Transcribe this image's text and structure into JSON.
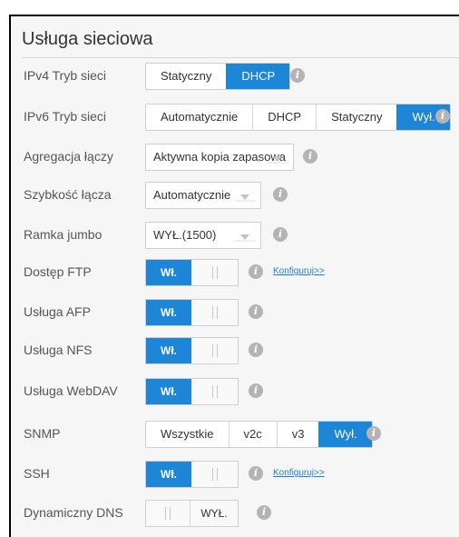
{
  "section": {
    "title": "Usługa sieciowa"
  },
  "colors": {
    "accent": "#1d86d6",
    "info_icon": "#b4b4b4",
    "link": "#1d7fd2"
  },
  "rows": {
    "ipv4": {
      "label": "IPv4 Tryb sieci",
      "options": [
        "Statyczny",
        "DHCP"
      ],
      "selected": "DHCP"
    },
    "ipv6": {
      "label": "IPv6 Tryb sieci",
      "options": [
        "Automatycznie",
        "DHCP",
        "Statyczny",
        "Wył."
      ],
      "selected": "Wył."
    },
    "aggregation": {
      "label": "Agregacja łączy",
      "value": "Aktywna kopia zapasowa"
    },
    "link_speed": {
      "label": "Szybkość łącza",
      "value": "Automatycznie"
    },
    "jumbo": {
      "label": "Ramka jumbo",
      "value": "WYŁ.(1500)"
    },
    "ftp": {
      "label": "Dostęp FTP",
      "state": "Wł.",
      "link": "Konfiguruj>>"
    },
    "afp": {
      "label": "Usługa AFP",
      "state": "Wł."
    },
    "nfs": {
      "label": "Usługa NFS",
      "state": "Wł."
    },
    "webdav": {
      "label": "Usługa WebDAV",
      "state": "Wł."
    },
    "snmp": {
      "label": "SNMP",
      "options": [
        "Wszystkie",
        "v2c",
        "v3",
        "Wył."
      ],
      "selected": "Wył."
    },
    "ssh": {
      "label": "SSH",
      "state": "Wł.",
      "link": "Konfiguruj>>"
    },
    "ddns": {
      "label": "Dynamiczny DNS",
      "state": "WYŁ."
    }
  },
  "icons": {
    "info": "info-icon",
    "caret": "chevron-down-icon",
    "grip": "toggle-grip-icon"
  }
}
